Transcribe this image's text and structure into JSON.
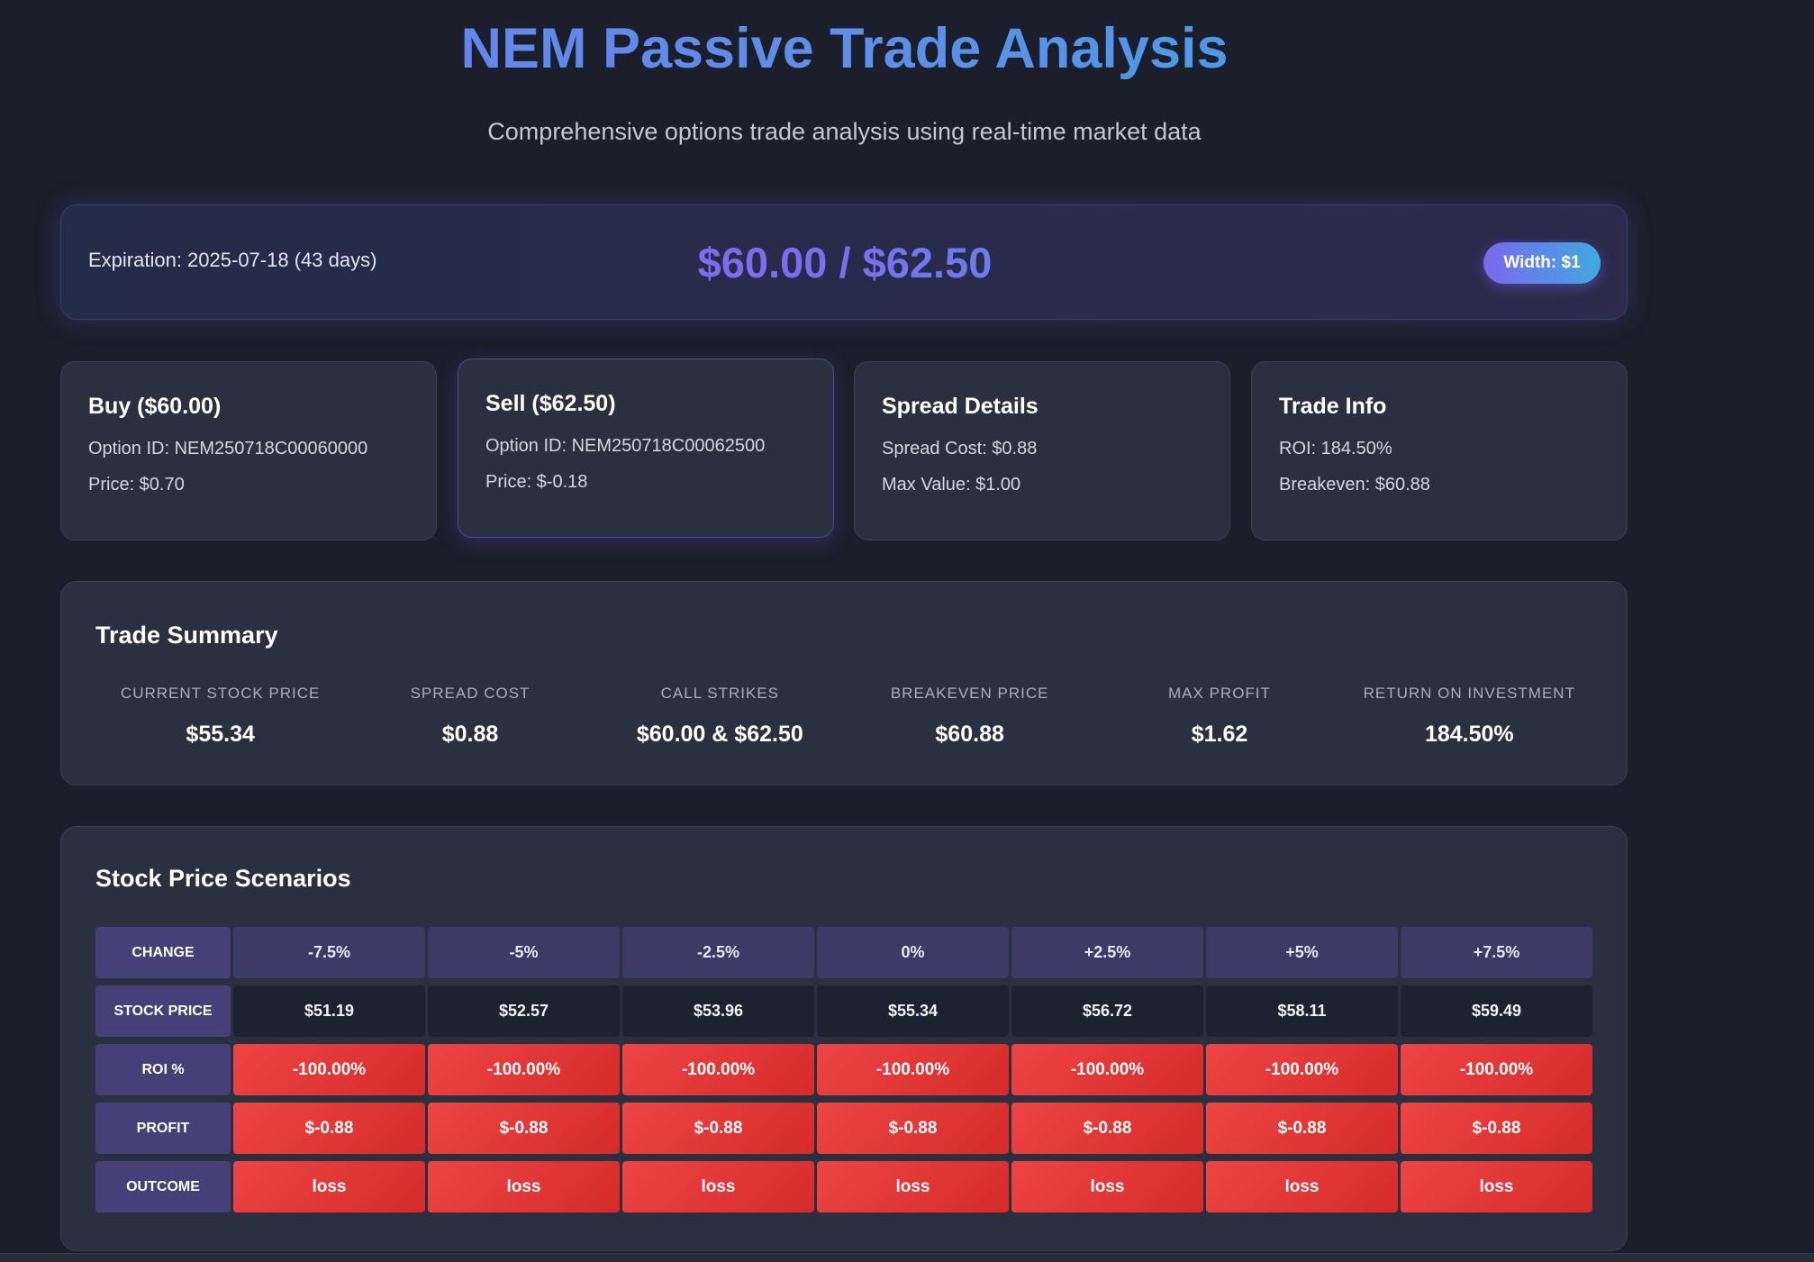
{
  "header": {
    "title": "NEM Passive Trade Analysis",
    "subtitle": "Comprehensive options trade analysis using real-time market data"
  },
  "banner": {
    "expiration": "Expiration: 2025-07-18 (43 days)",
    "strikes": "$60.00 / $62.50",
    "width_badge": "Width: $1"
  },
  "cards": {
    "buy": {
      "title": "Buy ($60.00)",
      "option_id": "Option ID: NEM250718C00060000",
      "price": "Price: $0.70"
    },
    "sell": {
      "title": "Sell ($62.50)",
      "option_id": "Option ID: NEM250718C00062500",
      "price": "Price: $-0.18"
    },
    "spread": {
      "title": "Spread Details",
      "cost": "Spread Cost: $0.88",
      "max_value": "Max Value: $1.00"
    },
    "trade": {
      "title": "Trade Info",
      "roi": "ROI: 184.50%",
      "breakeven": "Breakeven: $60.88"
    }
  },
  "summary": {
    "title": "Trade Summary",
    "metrics": [
      {
        "label": "CURRENT STOCK PRICE",
        "value": "$55.34"
      },
      {
        "label": "SPREAD COST",
        "value": "$0.88"
      },
      {
        "label": "CALL STRIKES",
        "value": "$60.00 & $62.50"
      },
      {
        "label": "BREAKEVEN PRICE",
        "value": "$60.88"
      },
      {
        "label": "MAX PROFIT",
        "value": "$1.62"
      },
      {
        "label": "RETURN ON INVESTMENT",
        "value": "184.50%"
      }
    ]
  },
  "scenarios": {
    "title": "Stock Price Scenarios",
    "row_labels": [
      "CHANGE",
      "STOCK PRICE",
      "ROI %",
      "PROFIT",
      "OUTCOME"
    ],
    "columns": [
      {
        "change": "-7.5%",
        "price": "$51.19",
        "roi": "-100.00%",
        "profit": "$-0.88",
        "outcome": "loss"
      },
      {
        "change": "-5%",
        "price": "$52.57",
        "roi": "-100.00%",
        "profit": "$-0.88",
        "outcome": "loss"
      },
      {
        "change": "-2.5%",
        "price": "$53.96",
        "roi": "-100.00%",
        "profit": "$-0.88",
        "outcome": "loss"
      },
      {
        "change": "0%",
        "price": "$55.34",
        "roi": "-100.00%",
        "profit": "$-0.88",
        "outcome": "loss"
      },
      {
        "change": "+2.5%",
        "price": "$56.72",
        "roi": "-100.00%",
        "profit": "$-0.88",
        "outcome": "loss"
      },
      {
        "change": "+5%",
        "price": "$58.11",
        "roi": "-100.00%",
        "profit": "$-0.88",
        "outcome": "loss"
      },
      {
        "change": "+7.5%",
        "price": "$59.49",
        "roi": "-100.00%",
        "profit": "$-0.88",
        "outcome": "loss"
      }
    ]
  },
  "colors": {
    "background": "#1b1f2b",
    "card": "#2a3040",
    "loss": "#ef4444",
    "row_header": "#463f78",
    "accent_start": "#6a7cf0",
    "accent_end": "#3aa4e6"
  }
}
